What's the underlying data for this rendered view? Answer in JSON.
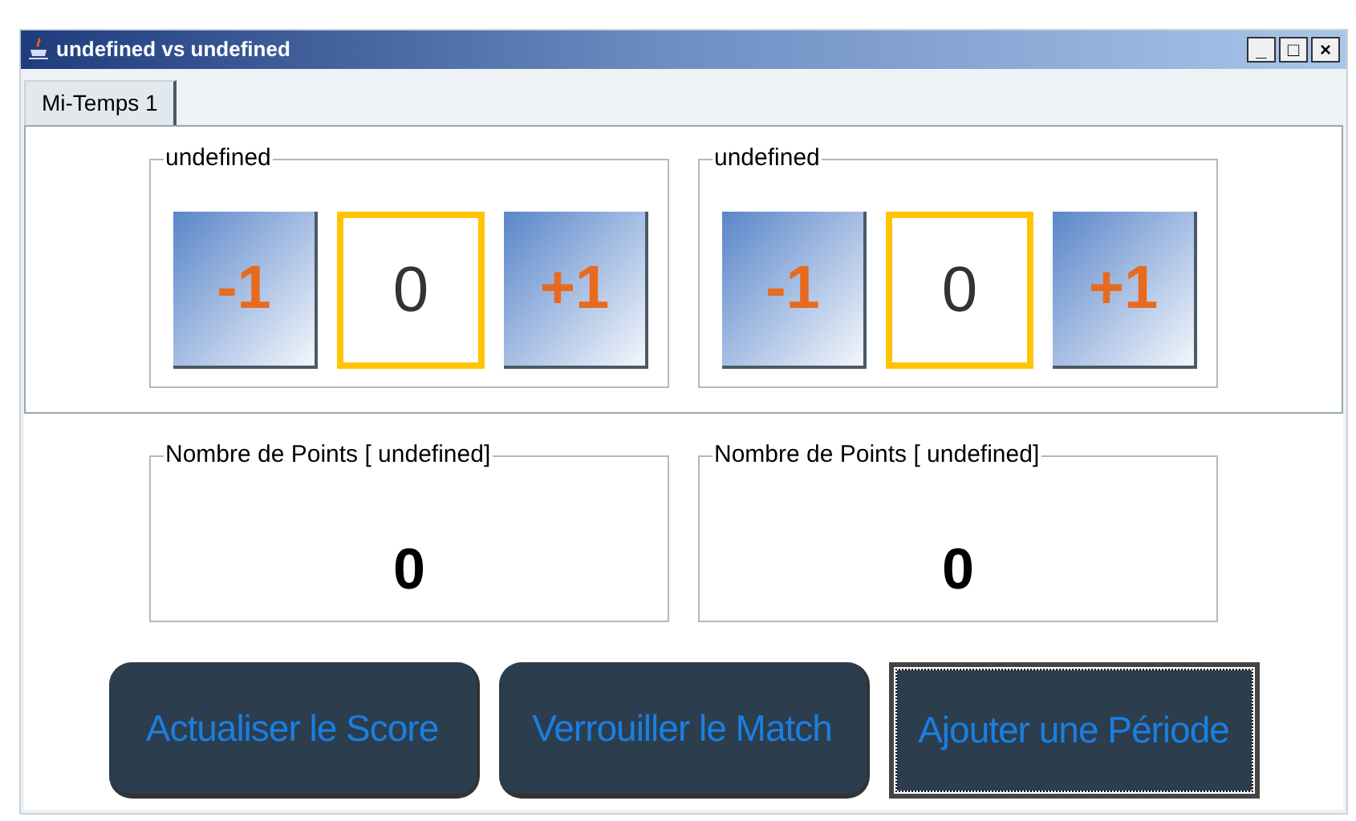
{
  "window": {
    "title": "undefined vs undefined",
    "controls": [
      "_",
      "□",
      "×"
    ]
  },
  "tabs": [
    {
      "label": "Mi-Temps 1",
      "selected": true
    }
  ],
  "teams": [
    {
      "label": "undefined",
      "minus": "-1",
      "score": "0",
      "plus": "+1"
    },
    {
      "label": "undefined",
      "minus": "-1",
      "score": "0",
      "plus": "+1"
    }
  ],
  "points": [
    {
      "label": "Nombre de Points [ undefined]",
      "value": "0"
    },
    {
      "label": "Nombre de Points [ undefined]",
      "value": "0"
    }
  ],
  "actions": [
    {
      "label": "Actualiser le Score",
      "focused": false
    },
    {
      "label": "Verrouiller le Match",
      "focused": false
    },
    {
      "label": "Ajouter une Période",
      "focused": true
    }
  ]
}
